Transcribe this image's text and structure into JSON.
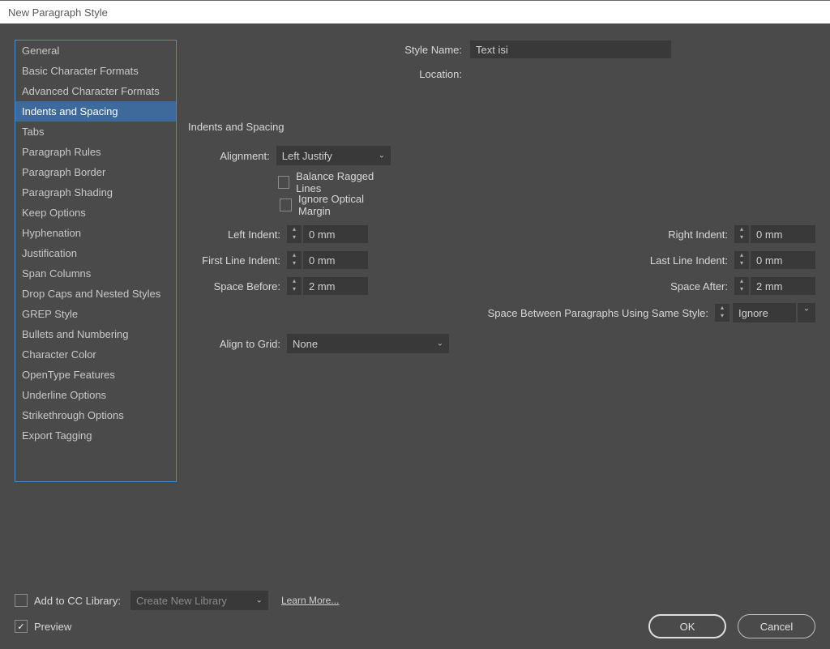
{
  "window": {
    "title": "New Paragraph Style"
  },
  "sidebar": {
    "items": [
      "General",
      "Basic Character Formats",
      "Advanced Character Formats",
      "Indents and Spacing",
      "Tabs",
      "Paragraph Rules",
      "Paragraph Border",
      "Paragraph Shading",
      "Keep Options",
      "Hyphenation",
      "Justification",
      "Span Columns",
      "Drop Caps and Nested Styles",
      "GREP Style",
      "Bullets and Numbering",
      "Character Color",
      "OpenType Features",
      "Underline Options",
      "Strikethrough Options",
      "Export Tagging"
    ],
    "selected_index": 3
  },
  "header": {
    "style_name_label": "Style Name:",
    "style_name_value": "Text isi",
    "location_label": "Location:",
    "location_value": ""
  },
  "section": {
    "title": "Indents and Spacing"
  },
  "form": {
    "alignment_label": "Alignment:",
    "alignment_value": "Left Justify",
    "balance_label": "Balance Ragged Lines",
    "balance_checked": false,
    "ignore_optical_label": "Ignore Optical Margin",
    "ignore_optical_checked": false,
    "left_indent_label": "Left Indent:",
    "left_indent_value": "0 mm",
    "right_indent_label": "Right Indent:",
    "right_indent_value": "0 mm",
    "first_line_label": "First Line Indent:",
    "first_line_value": "0 mm",
    "last_line_label": "Last Line Indent:",
    "last_line_value": "0 mm",
    "space_before_label": "Space Before:",
    "space_before_value": "2 mm",
    "space_after_label": "Space After:",
    "space_after_value": "2 mm",
    "space_between_label": "Space Between Paragraphs Using Same Style:",
    "space_between_value": "Ignore",
    "align_grid_label": "Align to Grid:",
    "align_grid_value": "None"
  },
  "footer": {
    "add_cc_label": "Add to CC Library:",
    "add_cc_checked": false,
    "cc_library_value": "Create New Library",
    "learn_more": "Learn More...",
    "preview_label": "Preview",
    "preview_checked": true,
    "ok": "OK",
    "cancel": "Cancel"
  }
}
